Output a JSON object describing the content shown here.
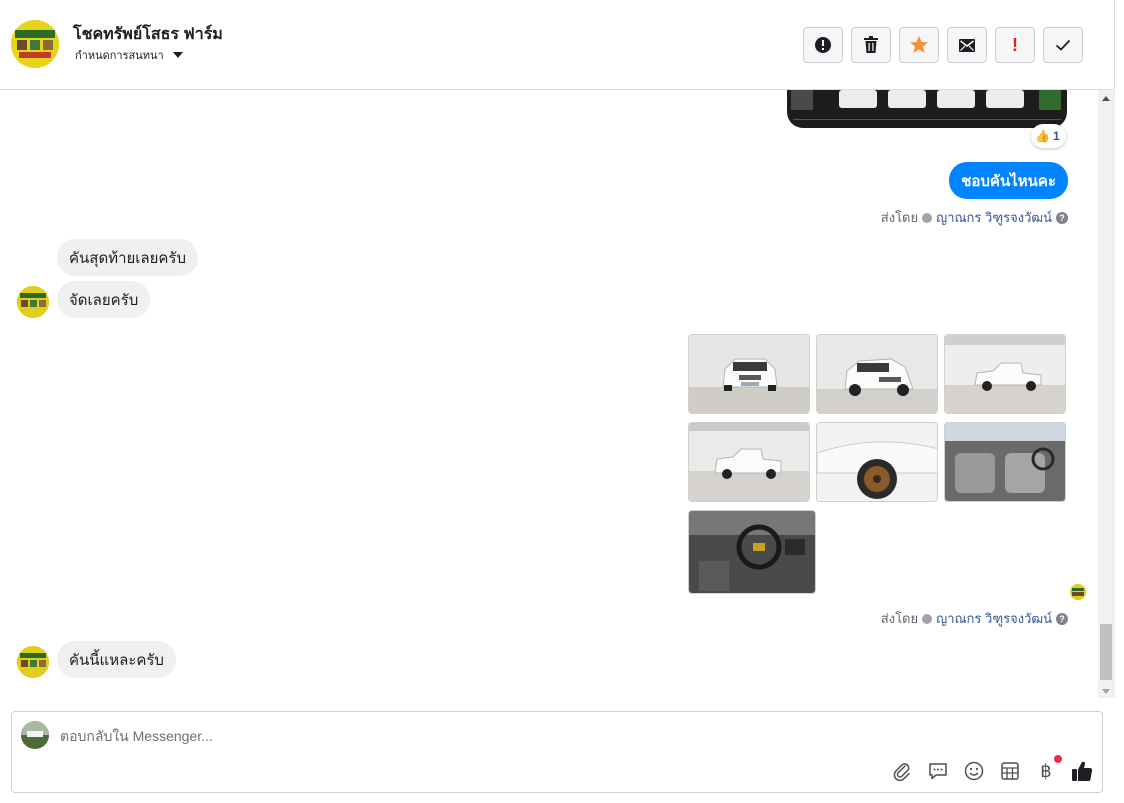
{
  "header": {
    "page_name": "โชคทรัพย์โสธร ฟาร์ม",
    "assign_label": "กำหนดการสนทนา",
    "actions": [
      {
        "name": "report-spam-button",
        "icon": "exclamation-circle-icon"
      },
      {
        "name": "delete-button",
        "icon": "trash-icon"
      },
      {
        "name": "star-button",
        "icon": "star-icon",
        "color": "#f7923b"
      },
      {
        "name": "mark-unread-button",
        "icon": "envelope-icon"
      },
      {
        "name": "follow-up-button",
        "icon": "red-exclamation-icon",
        "label": "!",
        "color": "#e02020"
      },
      {
        "name": "mark-done-button",
        "icon": "check-icon"
      }
    ]
  },
  "thread": {
    "reaction": {
      "emoji": "👍",
      "count": "1"
    },
    "messages": [
      {
        "direction": "outgoing",
        "text": "ชอบคันไหนคะ"
      },
      {
        "direction": "incoming",
        "text": "คันสุดท้ายเลยครับ"
      },
      {
        "direction": "incoming",
        "text": "จัดเลยครับ"
      },
      {
        "direction": "incoming",
        "text": "คันนี้แหละครับ"
      }
    ],
    "sent_by_label": "ส่งโดย",
    "agent_name": "ญาณกร วิฑูรจงวัฒน์",
    "help_glyph": "?",
    "photo_count": 7
  },
  "composer": {
    "placeholder": "ตอบกลับใน Messenger...",
    "tools": [
      "paperclip-icon",
      "chat-bubble-icon",
      "emoji-icon",
      "table-icon",
      "baht-icon",
      "like-icon"
    ],
    "baht_glyph": "฿",
    "accent_color": "#0084ff"
  }
}
